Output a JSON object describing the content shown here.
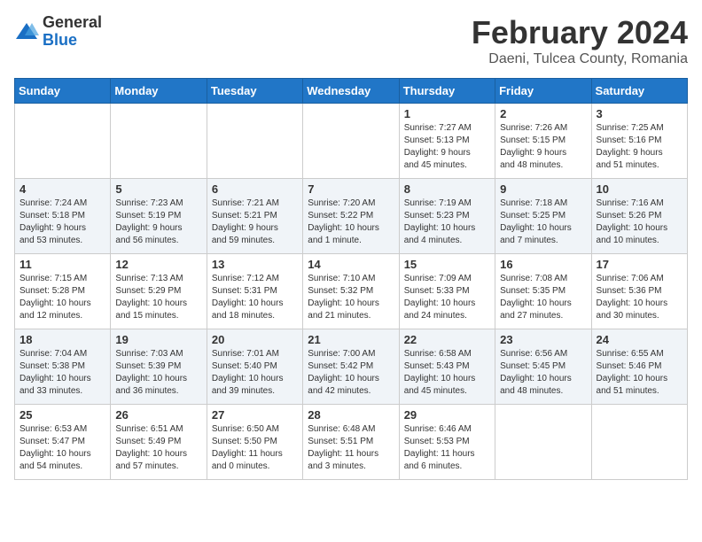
{
  "header": {
    "logo_general": "General",
    "logo_blue": "Blue",
    "main_title": "February 2024",
    "subtitle": "Daeni, Tulcea County, Romania"
  },
  "calendar": {
    "days_of_week": [
      "Sunday",
      "Monday",
      "Tuesday",
      "Wednesday",
      "Thursday",
      "Friday",
      "Saturday"
    ],
    "weeks": [
      [
        {
          "day": "",
          "info": ""
        },
        {
          "day": "",
          "info": ""
        },
        {
          "day": "",
          "info": ""
        },
        {
          "day": "",
          "info": ""
        },
        {
          "day": "1",
          "info": "Sunrise: 7:27 AM\nSunset: 5:13 PM\nDaylight: 9 hours\nand 45 minutes."
        },
        {
          "day": "2",
          "info": "Sunrise: 7:26 AM\nSunset: 5:15 PM\nDaylight: 9 hours\nand 48 minutes."
        },
        {
          "day": "3",
          "info": "Sunrise: 7:25 AM\nSunset: 5:16 PM\nDaylight: 9 hours\nand 51 minutes."
        }
      ],
      [
        {
          "day": "4",
          "info": "Sunrise: 7:24 AM\nSunset: 5:18 PM\nDaylight: 9 hours\nand 53 minutes."
        },
        {
          "day": "5",
          "info": "Sunrise: 7:23 AM\nSunset: 5:19 PM\nDaylight: 9 hours\nand 56 minutes."
        },
        {
          "day": "6",
          "info": "Sunrise: 7:21 AM\nSunset: 5:21 PM\nDaylight: 9 hours\nand 59 minutes."
        },
        {
          "day": "7",
          "info": "Sunrise: 7:20 AM\nSunset: 5:22 PM\nDaylight: 10 hours\nand 1 minute."
        },
        {
          "day": "8",
          "info": "Sunrise: 7:19 AM\nSunset: 5:23 PM\nDaylight: 10 hours\nand 4 minutes."
        },
        {
          "day": "9",
          "info": "Sunrise: 7:18 AM\nSunset: 5:25 PM\nDaylight: 10 hours\nand 7 minutes."
        },
        {
          "day": "10",
          "info": "Sunrise: 7:16 AM\nSunset: 5:26 PM\nDaylight: 10 hours\nand 10 minutes."
        }
      ],
      [
        {
          "day": "11",
          "info": "Sunrise: 7:15 AM\nSunset: 5:28 PM\nDaylight: 10 hours\nand 12 minutes."
        },
        {
          "day": "12",
          "info": "Sunrise: 7:13 AM\nSunset: 5:29 PM\nDaylight: 10 hours\nand 15 minutes."
        },
        {
          "day": "13",
          "info": "Sunrise: 7:12 AM\nSunset: 5:31 PM\nDaylight: 10 hours\nand 18 minutes."
        },
        {
          "day": "14",
          "info": "Sunrise: 7:10 AM\nSunset: 5:32 PM\nDaylight: 10 hours\nand 21 minutes."
        },
        {
          "day": "15",
          "info": "Sunrise: 7:09 AM\nSunset: 5:33 PM\nDaylight: 10 hours\nand 24 minutes."
        },
        {
          "day": "16",
          "info": "Sunrise: 7:08 AM\nSunset: 5:35 PM\nDaylight: 10 hours\nand 27 minutes."
        },
        {
          "day": "17",
          "info": "Sunrise: 7:06 AM\nSunset: 5:36 PM\nDaylight: 10 hours\nand 30 minutes."
        }
      ],
      [
        {
          "day": "18",
          "info": "Sunrise: 7:04 AM\nSunset: 5:38 PM\nDaylight: 10 hours\nand 33 minutes."
        },
        {
          "day": "19",
          "info": "Sunrise: 7:03 AM\nSunset: 5:39 PM\nDaylight: 10 hours\nand 36 minutes."
        },
        {
          "day": "20",
          "info": "Sunrise: 7:01 AM\nSunset: 5:40 PM\nDaylight: 10 hours\nand 39 minutes."
        },
        {
          "day": "21",
          "info": "Sunrise: 7:00 AM\nSunset: 5:42 PM\nDaylight: 10 hours\nand 42 minutes."
        },
        {
          "day": "22",
          "info": "Sunrise: 6:58 AM\nSunset: 5:43 PM\nDaylight: 10 hours\nand 45 minutes."
        },
        {
          "day": "23",
          "info": "Sunrise: 6:56 AM\nSunset: 5:45 PM\nDaylight: 10 hours\nand 48 minutes."
        },
        {
          "day": "24",
          "info": "Sunrise: 6:55 AM\nSunset: 5:46 PM\nDaylight: 10 hours\nand 51 minutes."
        }
      ],
      [
        {
          "day": "25",
          "info": "Sunrise: 6:53 AM\nSunset: 5:47 PM\nDaylight: 10 hours\nand 54 minutes."
        },
        {
          "day": "26",
          "info": "Sunrise: 6:51 AM\nSunset: 5:49 PM\nDaylight: 10 hours\nand 57 minutes."
        },
        {
          "day": "27",
          "info": "Sunrise: 6:50 AM\nSunset: 5:50 PM\nDaylight: 11 hours\nand 0 minutes."
        },
        {
          "day": "28",
          "info": "Sunrise: 6:48 AM\nSunset: 5:51 PM\nDaylight: 11 hours\nand 3 minutes."
        },
        {
          "day": "29",
          "info": "Sunrise: 6:46 AM\nSunset: 5:53 PM\nDaylight: 11 hours\nand 6 minutes."
        },
        {
          "day": "",
          "info": ""
        },
        {
          "day": "",
          "info": ""
        }
      ]
    ]
  }
}
